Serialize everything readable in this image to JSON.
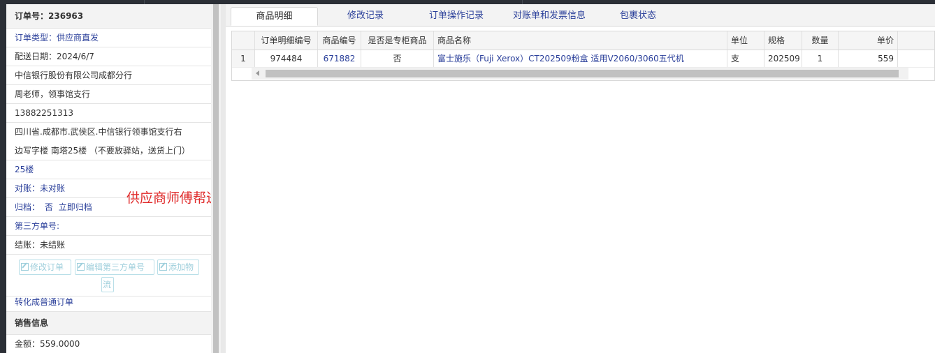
{
  "order": {
    "number_label": "订单号：",
    "number": "236963",
    "type": "订单类型：供应商直发",
    "delivery_date": "配送日期：2024/6/7",
    "company": "中信银行股份有限公司成都分行",
    "contact": "周老师，领事馆支行",
    "phone": "13882251313",
    "address_line1": "四川省.成都市.武侯区.中信银行领事馆支行右",
    "address_line2": "边写字楼 南塔25楼 （不要放驿站，送货上门）",
    "floor": "25楼",
    "reconcile": "对账：未对账",
    "archive_label": "归档：",
    "archive_value": "否",
    "archive_action": "立即归档",
    "third_party_no": "第三方单号:",
    "settlement": "结账：未结账",
    "note": "供应商师傅帮送",
    "buttons": {
      "edit_order": "修改订单",
      "edit_third_party": "编辑第三方单号",
      "add_logistics_1": "添加物",
      "add_logistics_2": "流"
    },
    "convert": "转化成普通订单",
    "sales_header": "销售信息",
    "amount": "金额：559.0000"
  },
  "tabs": [
    {
      "label": "商品明细",
      "active": true
    },
    {
      "label": "修改记录",
      "active": false
    },
    {
      "label": "订单操作记录",
      "active": false
    },
    {
      "label": "对账单和发票信息",
      "active": false
    },
    {
      "label": "包裹状态",
      "active": false
    }
  ],
  "table": {
    "columns": [
      "",
      "订单明细编号",
      "商品编号",
      "是否是专柜商品",
      "商品名称",
      "单位",
      "规格",
      "数量",
      "单价"
    ],
    "rows": [
      [
        "1",
        "974484",
        "671882",
        "否",
        "富士施乐（Fuji Xerox）CT202509粉盒 适用V2060/3060五代机",
        "支",
        "202509",
        "1",
        "559"
      ]
    ]
  },
  "colors": {
    "link_blue": "#2a3f9a",
    "note_red": "#e02b2b",
    "disabled_button": "#9fcfdc"
  }
}
